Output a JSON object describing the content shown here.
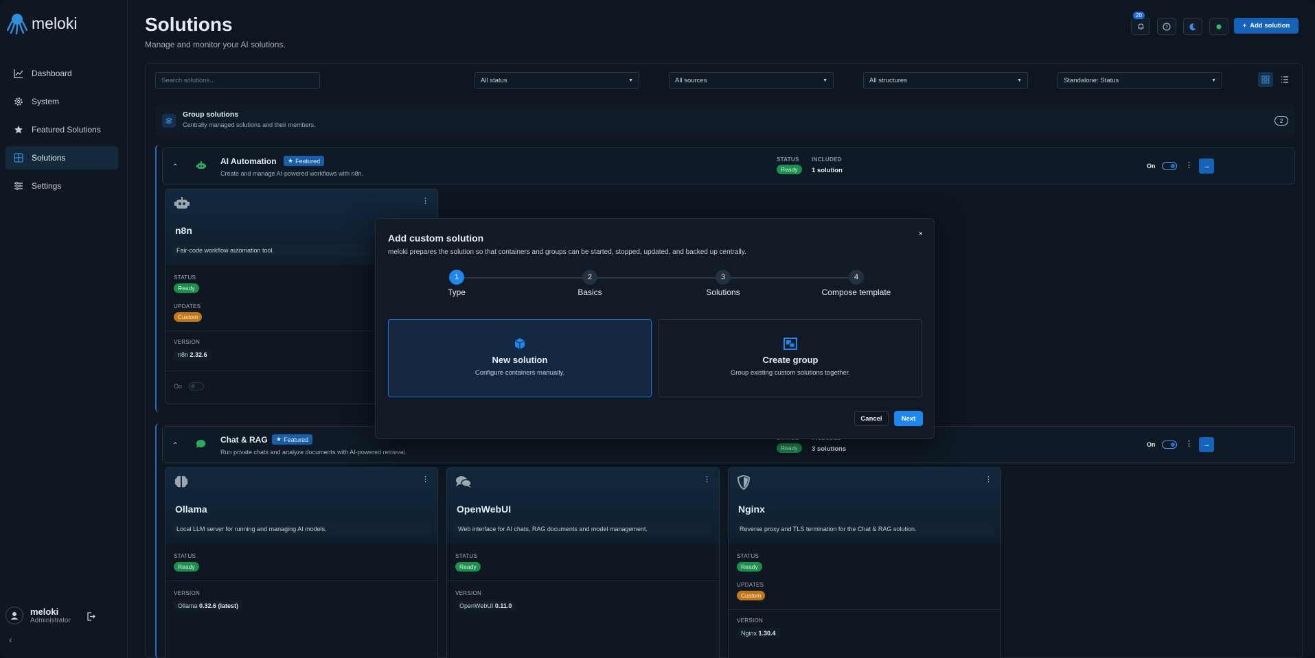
{
  "brand": {
    "name": "meloki"
  },
  "sidebar": {
    "items": [
      {
        "label": "Dashboard",
        "icon": "chart-line-icon"
      },
      {
        "label": "System",
        "icon": "gear-icon"
      },
      {
        "label": "Featured Solutions",
        "icon": "star-icon"
      },
      {
        "label": "Solutions",
        "icon": "grid-icon",
        "active": true
      },
      {
        "label": "Settings",
        "icon": "sliders-icon"
      }
    ],
    "user": {
      "name": "meloki",
      "role": "Administrator"
    }
  },
  "header": {
    "title": "Solutions",
    "subtitle": "Manage and monitor your AI solutions.",
    "notifications": "20",
    "add_button": "Add solution"
  },
  "filters": {
    "search_placeholder": "Search solutions...",
    "status": "All status",
    "sources": "All sources",
    "structures": "All structures",
    "standalone": "Standalone: Status"
  },
  "group_section": {
    "title": "Group solutions",
    "subtitle": "Centrally managed solutions and their members.",
    "count": "2"
  },
  "groups": [
    {
      "title": "AI Automation",
      "featured": "Featured",
      "subtitle": "Create and manage AI-powered workflows with n8n.",
      "status_label": "STATUS",
      "status": "Ready",
      "included_label": "INCLUDED",
      "included": "1 solution",
      "toggle_label": "On"
    },
    {
      "title": "Chat & RAG",
      "featured": "Featured",
      "subtitle": "Run private chats and analyze documents with AI-powered retrieval.",
      "status_label": "STATUS",
      "status": "Ready",
      "included_label": "INCLUDED",
      "included": "3 solutions",
      "toggle_label": "On"
    }
  ],
  "cards": {
    "n8n": {
      "name": "n8n",
      "desc": "Fair-code workflow automation tool.",
      "status_label": "STATUS",
      "status": "Ready",
      "updates_label": "UPDATES",
      "updates": "Custom",
      "version_label": "VERSION",
      "version_name": "n8n",
      "version": "2.32.6",
      "toggle_label": "On"
    },
    "ollama": {
      "name": "Ollama",
      "desc": "Local LLM server for running and managing AI models.",
      "status_label": "STATUS",
      "status": "Ready",
      "version_label": "VERSION",
      "version_name": "Ollama",
      "version": "0.32.6 (latest)"
    },
    "openwebui": {
      "name": "OpenWebUI",
      "desc": "Web interface for AI chats, RAG documents and model management.",
      "status_label": "STATUS",
      "status": "Ready",
      "version_label": "VERSION",
      "version_name": "OpenWebUI",
      "version": "0.11.0"
    },
    "nginx": {
      "name": "Nginx",
      "desc": "Reverse proxy and TLS termination for the Chat & RAG solution.",
      "status_label": "STATUS",
      "status": "Ready",
      "updates_label": "UPDATES",
      "updates": "Custom",
      "version_label": "VERSION",
      "version_name": "Nginx",
      "version": "1.30.4"
    }
  },
  "modal": {
    "title": "Add custom solution",
    "close": "×",
    "subtitle": "meloki prepares the solution so that containers and groups can be started, stopped, updated, and backed up centrally.",
    "steps": [
      {
        "num": "1",
        "label": "Type"
      },
      {
        "num": "2",
        "label": "Basics"
      },
      {
        "num": "3",
        "label": "Solutions"
      },
      {
        "num": "4",
        "label": "Compose template"
      }
    ],
    "options": [
      {
        "title": "New solution",
        "sub": "Configure containers manually."
      },
      {
        "title": "Create group",
        "sub": "Group existing custom solutions together."
      }
    ],
    "cancel": "Cancel",
    "next": "Next"
  },
  "colors": {
    "accent": "#1e87f0",
    "ready": "#1c8f4e",
    "custom": "#c07818",
    "featured": "#1a5ea8"
  }
}
